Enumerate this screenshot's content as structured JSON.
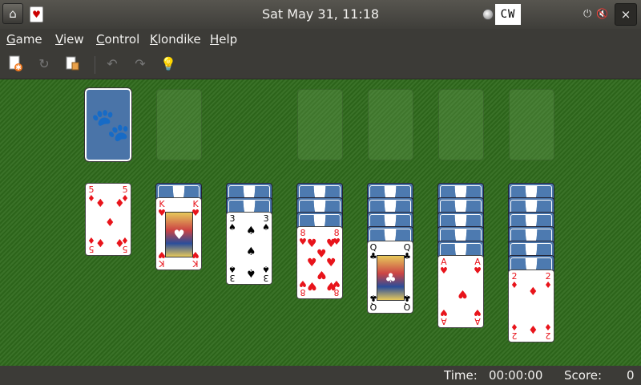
{
  "topbar": {
    "clock": "Sat May 31, 11:18",
    "keyboard_indicator": "CW",
    "close_label": "×",
    "home_icon": "home-icon",
    "app_icon": "solitaire-icon"
  },
  "menu": {
    "items": [
      {
        "label": "Game",
        "mnemonic": "G"
      },
      {
        "label": "View",
        "mnemonic": "V"
      },
      {
        "label": "Control",
        "mnemonic": "C"
      },
      {
        "label": "Klondike",
        "mnemonic": "K"
      },
      {
        "label": "Help",
        "mnemonic": "H"
      }
    ]
  },
  "toolbar": {
    "buttons": [
      "new-game-icon",
      "restart-icon",
      "deal-icon",
      "undo-icon",
      "redo-icon",
      "hint-icon"
    ]
  },
  "board": {
    "stock": {
      "face_down": true
    },
    "tableau": [
      {
        "face_down": 0,
        "face_up": [
          {
            "rank": "5",
            "suit": "♦",
            "color": "red"
          }
        ]
      },
      {
        "face_down": 1,
        "face_up": [
          {
            "rank": "K",
            "suit": "♥",
            "color": "red"
          }
        ]
      },
      {
        "face_down": 2,
        "face_up": [
          {
            "rank": "3",
            "suit": "♠",
            "color": "black"
          }
        ]
      },
      {
        "face_down": 3,
        "face_up": [
          {
            "rank": "8",
            "suit": "♥",
            "color": "red"
          }
        ]
      },
      {
        "face_down": 4,
        "face_up": [
          {
            "rank": "Q",
            "suit": "♣",
            "color": "black"
          }
        ]
      },
      {
        "face_down": 5,
        "face_up": [
          {
            "rank": "A",
            "suit": "♥",
            "color": "red"
          }
        ]
      },
      {
        "face_down": 6,
        "face_up": [
          {
            "rank": "2",
            "suit": "♦",
            "color": "red"
          }
        ]
      }
    ]
  },
  "status": {
    "time_label": "Time:",
    "time_value": "00:00:00",
    "score_label": "Score:",
    "score_value": "0"
  },
  "colors": {
    "felt": "#2f6a1c",
    "card_back": "#4a74a8",
    "red_suit": "#e8141b",
    "panel": "#3c3b37"
  }
}
